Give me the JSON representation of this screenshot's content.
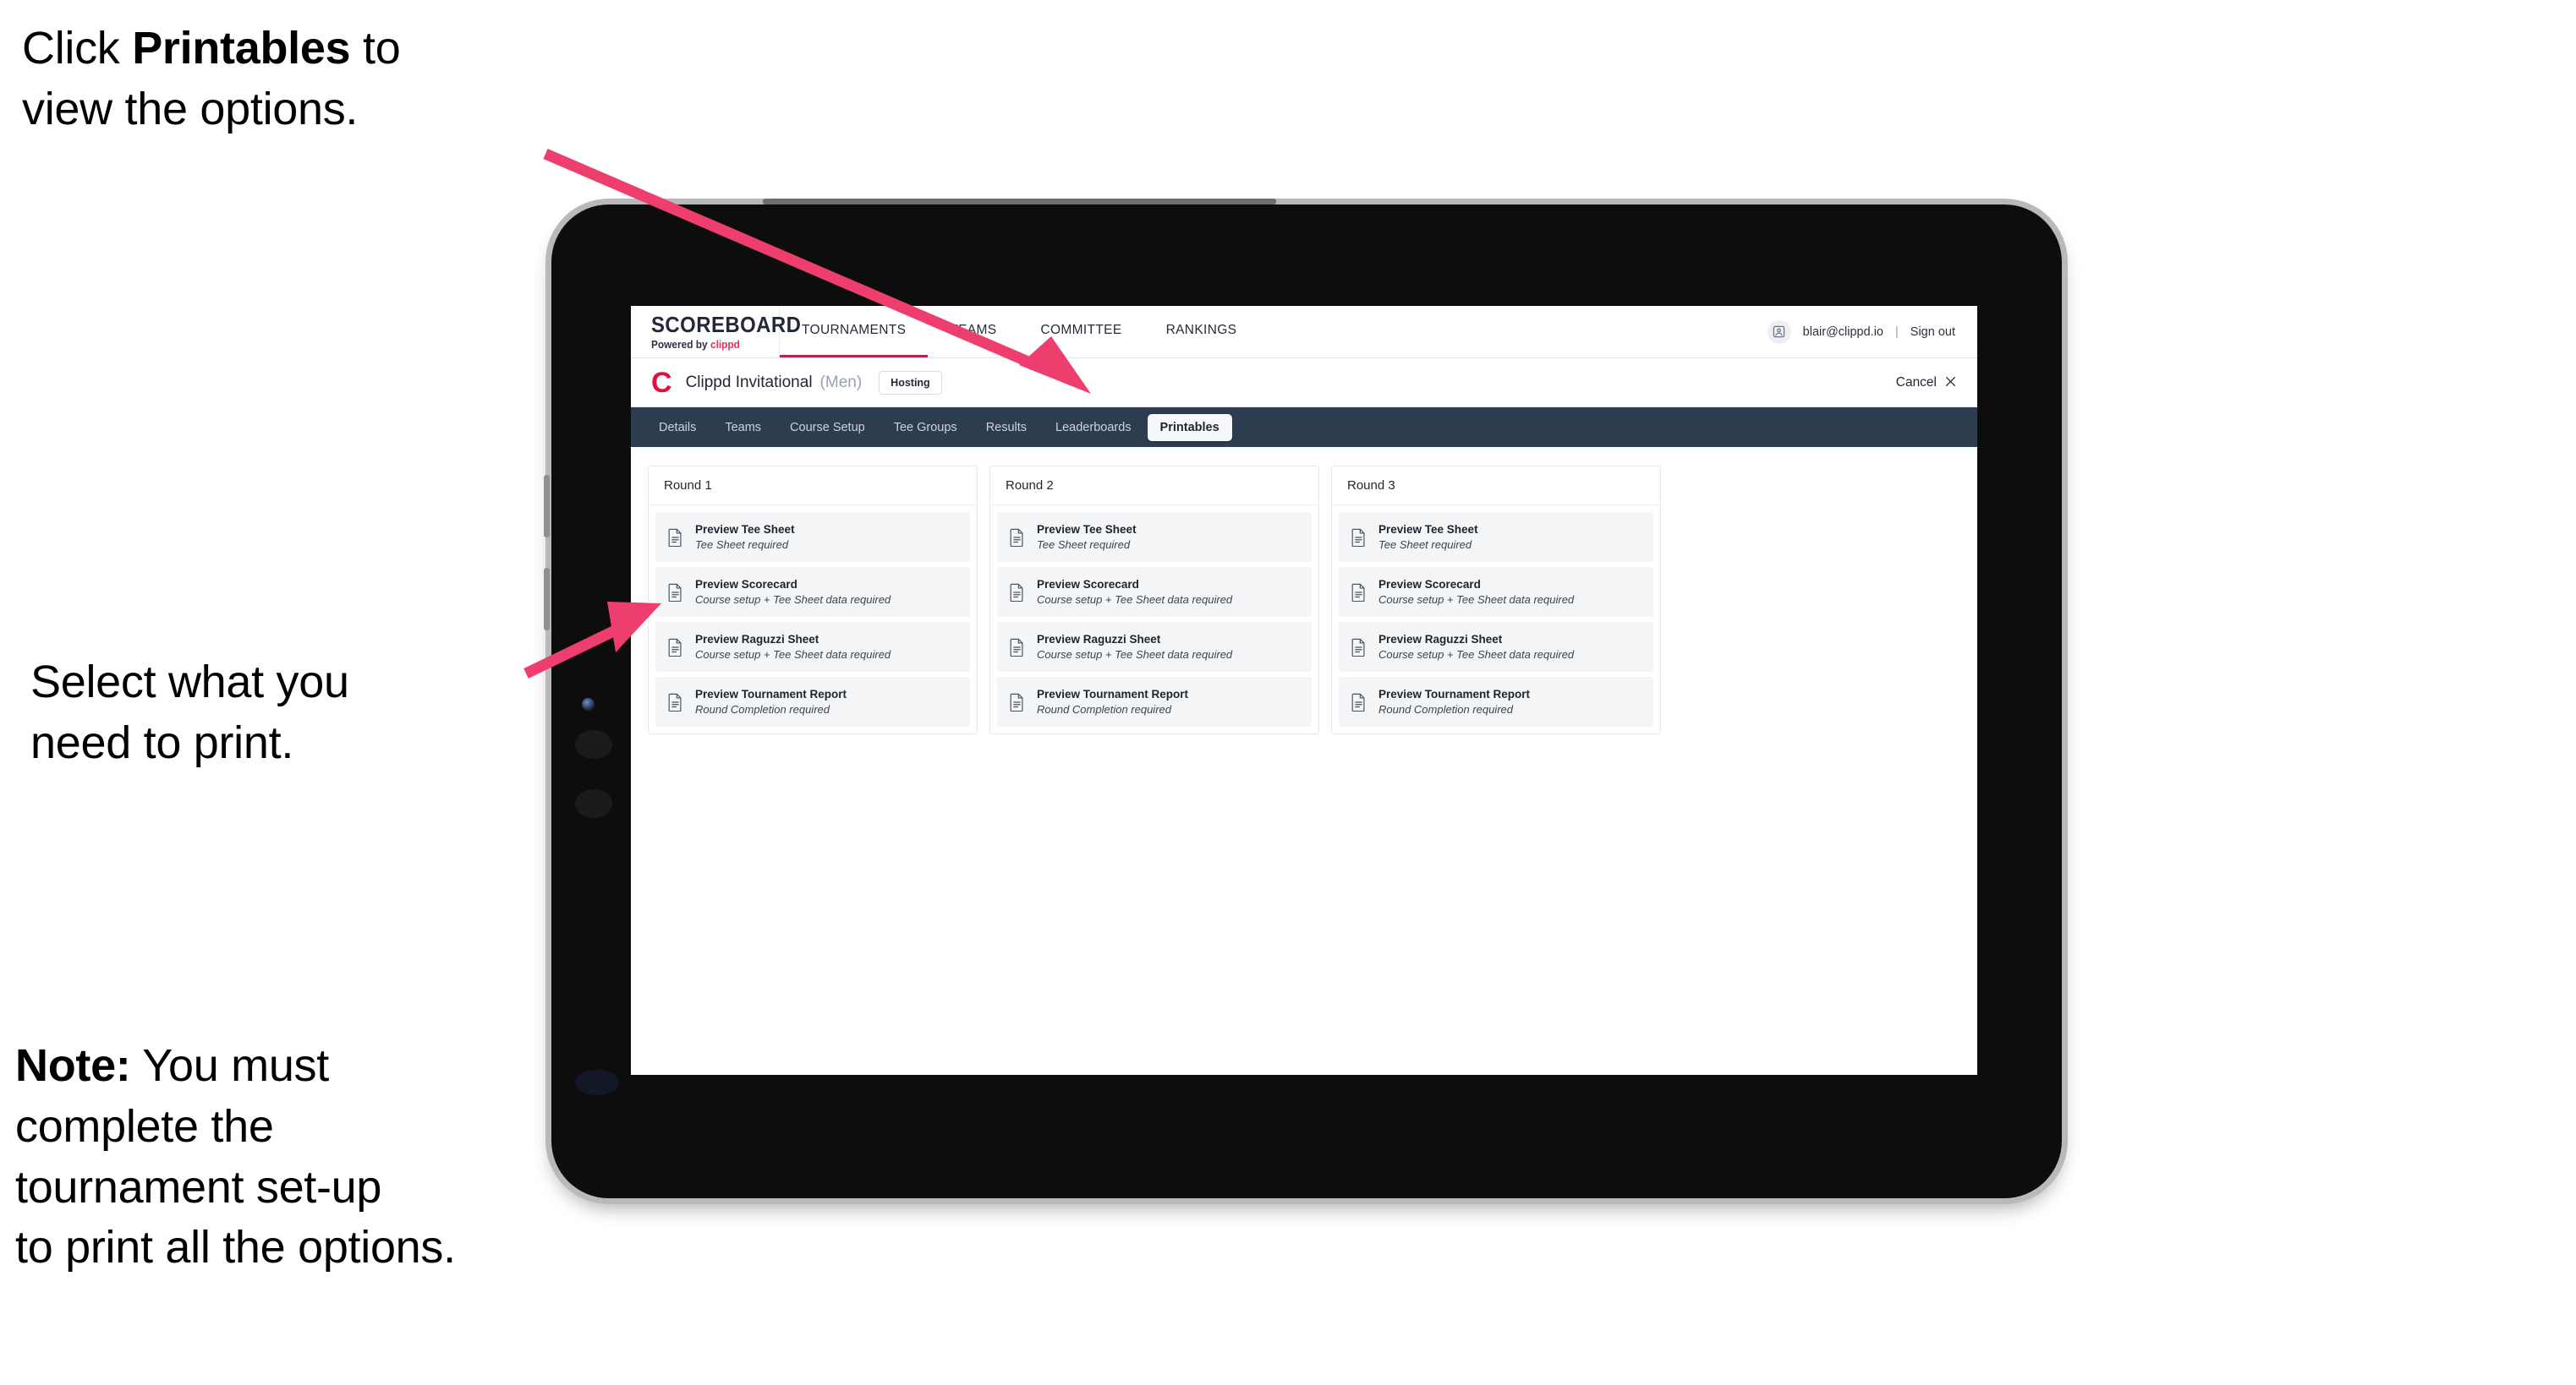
{
  "annotations": {
    "click_printables": {
      "prefix": "Click ",
      "bold": "Printables",
      "suffix": " to\nview the options."
    },
    "select_print": "Select what you\n need to print.",
    "note": {
      "label": "Note:",
      "body": " You must\ncomplete the\ntournament set-up\nto print all the options."
    }
  },
  "colors": {
    "accent_pink": "#ed3e6e",
    "brand_red": "#e0113f",
    "subnav_navy": "#2e3c50",
    "row_bg": "#f4f5f7"
  },
  "app": {
    "logo": {
      "word": "SCOREBOARD",
      "powered_prefix": "Powered by ",
      "brand": "clippd"
    },
    "topnav": [
      {
        "label": "TOURNAMENTS",
        "active": true
      },
      {
        "label": "TEAMS",
        "active": false
      },
      {
        "label": "COMMITTEE",
        "active": false
      },
      {
        "label": "RANKINGS",
        "active": false
      }
    ],
    "user": {
      "avatar_icon": "user-avatar-icon",
      "email": "blair@clippd.io",
      "separator": "|",
      "sign_out": "Sign out"
    },
    "tournament": {
      "logo_letter": "C",
      "name": "Clippd Invitational",
      "gender": "(Men)",
      "hosting_chip": "Hosting",
      "cancel": "Cancel",
      "cancel_icon": "close-icon"
    },
    "subnav": [
      {
        "label": "Details",
        "active": false
      },
      {
        "label": "Teams",
        "active": false
      },
      {
        "label": "Course Setup",
        "active": false
      },
      {
        "label": "Tee Groups",
        "active": false
      },
      {
        "label": "Results",
        "active": false
      },
      {
        "label": "Leaderboards",
        "active": false
      },
      {
        "label": "Printables",
        "active": true
      }
    ],
    "rounds": [
      {
        "heading": "Round 1",
        "items": [
          {
            "title": "Preview Tee Sheet",
            "subtitle": "Tee Sheet required"
          },
          {
            "title": "Preview Scorecard",
            "subtitle": "Course setup + Tee Sheet data required"
          },
          {
            "title": "Preview Raguzzi Sheet",
            "subtitle": "Course setup + Tee Sheet data required"
          },
          {
            "title": "Preview Tournament Report",
            "subtitle": "Round Completion required"
          }
        ]
      },
      {
        "heading": "Round 2",
        "items": [
          {
            "title": "Preview Tee Sheet",
            "subtitle": "Tee Sheet required"
          },
          {
            "title": "Preview Scorecard",
            "subtitle": "Course setup + Tee Sheet data required"
          },
          {
            "title": "Preview Raguzzi Sheet",
            "subtitle": "Course setup + Tee Sheet data required"
          },
          {
            "title": "Preview Tournament Report",
            "subtitle": "Round Completion required"
          }
        ]
      },
      {
        "heading": "Round 3",
        "items": [
          {
            "title": "Preview Tee Sheet",
            "subtitle": "Tee Sheet required"
          },
          {
            "title": "Preview Scorecard",
            "subtitle": "Course setup + Tee Sheet data required"
          },
          {
            "title": "Preview Raguzzi Sheet",
            "subtitle": "Course setup + Tee Sheet data required"
          },
          {
            "title": "Preview Tournament Report",
            "subtitle": "Round Completion required"
          }
        ]
      }
    ]
  }
}
